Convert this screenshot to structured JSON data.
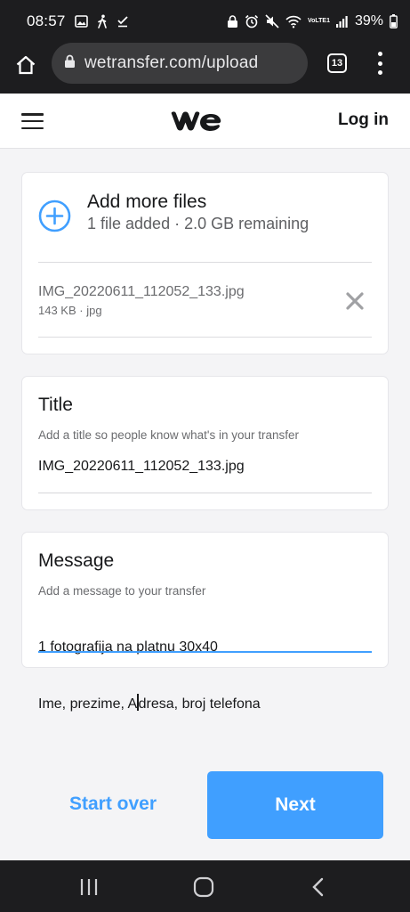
{
  "status_bar": {
    "time": "08:57",
    "battery": "39%",
    "network": "VoLTE1"
  },
  "browser": {
    "url": "wetransfer.com/upload",
    "tab_count": "13"
  },
  "header": {
    "logo": "we",
    "login_label": "Log in"
  },
  "files_card": {
    "add_title": "Add more files",
    "add_subtitle": "1 file added · 2.0 GB remaining",
    "files": [
      {
        "name": "IMG_20220611_112052_133.jpg",
        "meta": "143 KB · jpg"
      }
    ]
  },
  "title_card": {
    "label": "Title",
    "hint": "Add a title so people know what's in your transfer",
    "value": "IMG_20220611_112052_133.jpg"
  },
  "message_card": {
    "label": "Message",
    "hint": "Add a message to your transfer",
    "line1": "1 fotografija na platnu 30x40",
    "line2_before_caret": "Ime, prezime, A",
    "line2_after_caret": "dresa, broj telefona"
  },
  "actions": {
    "start_over_label": "Start over",
    "next_label": "Next"
  },
  "colors": {
    "accent": "#409fff",
    "system_bar": "#1d1d1f",
    "page_bg": "#f4f4f6"
  },
  "icons": [
    "gallery-icon",
    "walk-icon",
    "check-icon",
    "lock-icon",
    "alarm-icon",
    "mute-icon",
    "wifi-icon",
    "signal-icon",
    "battery-icon",
    "home-icon",
    "menu-icon",
    "plus-circle-icon",
    "close-icon",
    "recents-icon",
    "home-circle-icon",
    "back-icon"
  ]
}
